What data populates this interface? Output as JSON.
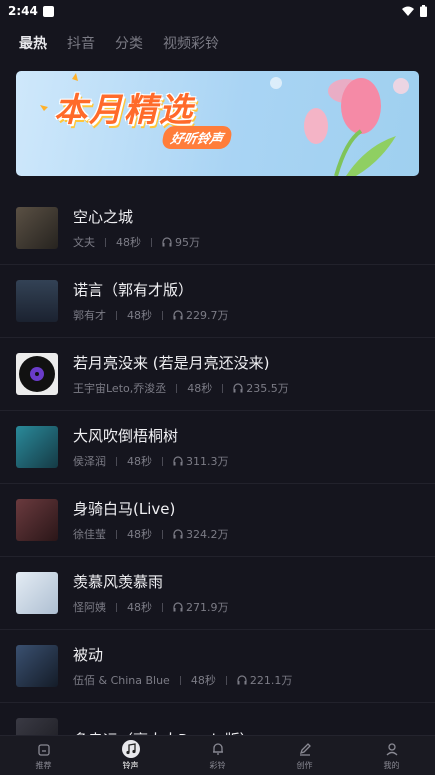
{
  "status": {
    "time": "2:44"
  },
  "tabs": [
    {
      "label": "最热",
      "active": true
    },
    {
      "label": "抖音",
      "active": false
    },
    {
      "label": "分类",
      "active": false
    },
    {
      "label": "视频彩铃",
      "active": false
    }
  ],
  "banner": {
    "title": "本月精选",
    "subtitle": "好听铃声"
  },
  "songs": [
    {
      "title": "空心之城",
      "artist": "文夫",
      "duration": "48秒",
      "plays": "95万",
      "cover_color": "#3a3630"
    },
    {
      "title": "诺言（郭有才版）",
      "artist": "郭有才",
      "duration": "48秒",
      "plays": "229.7万",
      "cover_color": "#2b3440"
    },
    {
      "title": "若月亮没来 (若是月亮还没来)",
      "artist": "王宇宙Leto,乔浚丞",
      "duration": "48秒",
      "plays": "235.5万",
      "cover_color": "#e8e8e8"
    },
    {
      "title": "大风吹倒梧桐树",
      "artist": "侯泽润",
      "duration": "48秒",
      "plays": "311.3万",
      "cover_color": "#1f6a7a"
    },
    {
      "title": "身骑白马(Live)",
      "artist": "徐佳莹",
      "duration": "48秒",
      "plays": "324.2万",
      "cover_color": "#4a2a30"
    },
    {
      "title": "羡慕风羡慕雨",
      "artist": "怪阿姨",
      "duration": "48秒",
      "plays": "271.9万",
      "cover_color": "#c8d6e6"
    },
    {
      "title": "被动",
      "artist": "伍佰 & China Blue",
      "duration": "48秒",
      "plays": "221.1万",
      "cover_color": "#2a3a50"
    },
    {
      "title": "多幸运（豪大大Remix版）",
      "artist": "",
      "duration": "",
      "plays": "",
      "cover_color": "#2a2a30"
    }
  ],
  "nav": [
    {
      "label": "推荐",
      "icon": "home-icon",
      "active": false
    },
    {
      "label": "铃声",
      "icon": "music-note-icon",
      "active": true
    },
    {
      "label": "彩铃",
      "icon": "bell-icon",
      "active": false
    },
    {
      "label": "创作",
      "icon": "pen-icon",
      "active": false
    },
    {
      "label": "我的",
      "icon": "user-icon",
      "active": false
    }
  ],
  "colors": {
    "background": "#15151e",
    "banner_title": "#ff6a2a",
    "accent": "#e8e8ec"
  }
}
